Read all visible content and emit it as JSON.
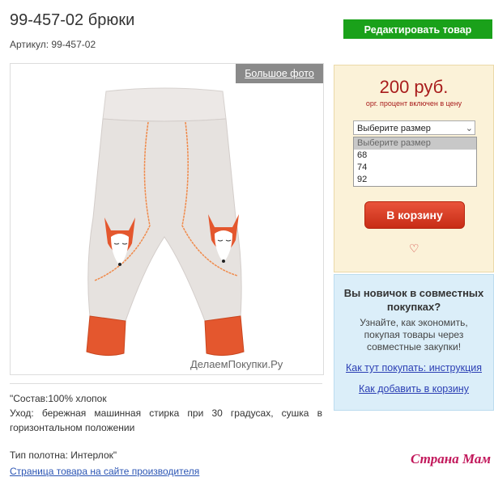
{
  "product": {
    "title": "99-457-02 брюки",
    "sku_label": "Артикул: 99-457-02",
    "big_photo_label": "Большое фото",
    "watermark": "ДелаемПокупки.Ру"
  },
  "toolbar": {
    "edit_label": "Редактировать товар"
  },
  "price_panel": {
    "price": "200 руб.",
    "note": "орг. процент включен в цену",
    "size_select": {
      "selected": "Выберите размер",
      "options": [
        "Выберите размер",
        "68",
        "74",
        "92"
      ]
    },
    "cart_label": "В корзину"
  },
  "info_panel": {
    "title": "Вы новичок в совместных покупках?",
    "text": "Узнайте, как экономить, покупая товары через совместные закупки!",
    "link1": "Как тут покупать: инструкция",
    "link2": "Как добавить в корзину"
  },
  "description": {
    "composition": "\"Состав:100% хлопок",
    "care": "Уход: бережная машинная стирка при 30 градусах, сушка в горизонтальном положении",
    "fabric": "Тип полотна: Интерлок\"",
    "maker_link": "Страница товара на сайте производителя"
  },
  "site_logo": "Страна Мам",
  "colors": {
    "edit_green": "#1aa11a",
    "price_red": "#a81c1c",
    "cart_red": "#d63b22",
    "link_blue": "#2b3fb4"
  }
}
